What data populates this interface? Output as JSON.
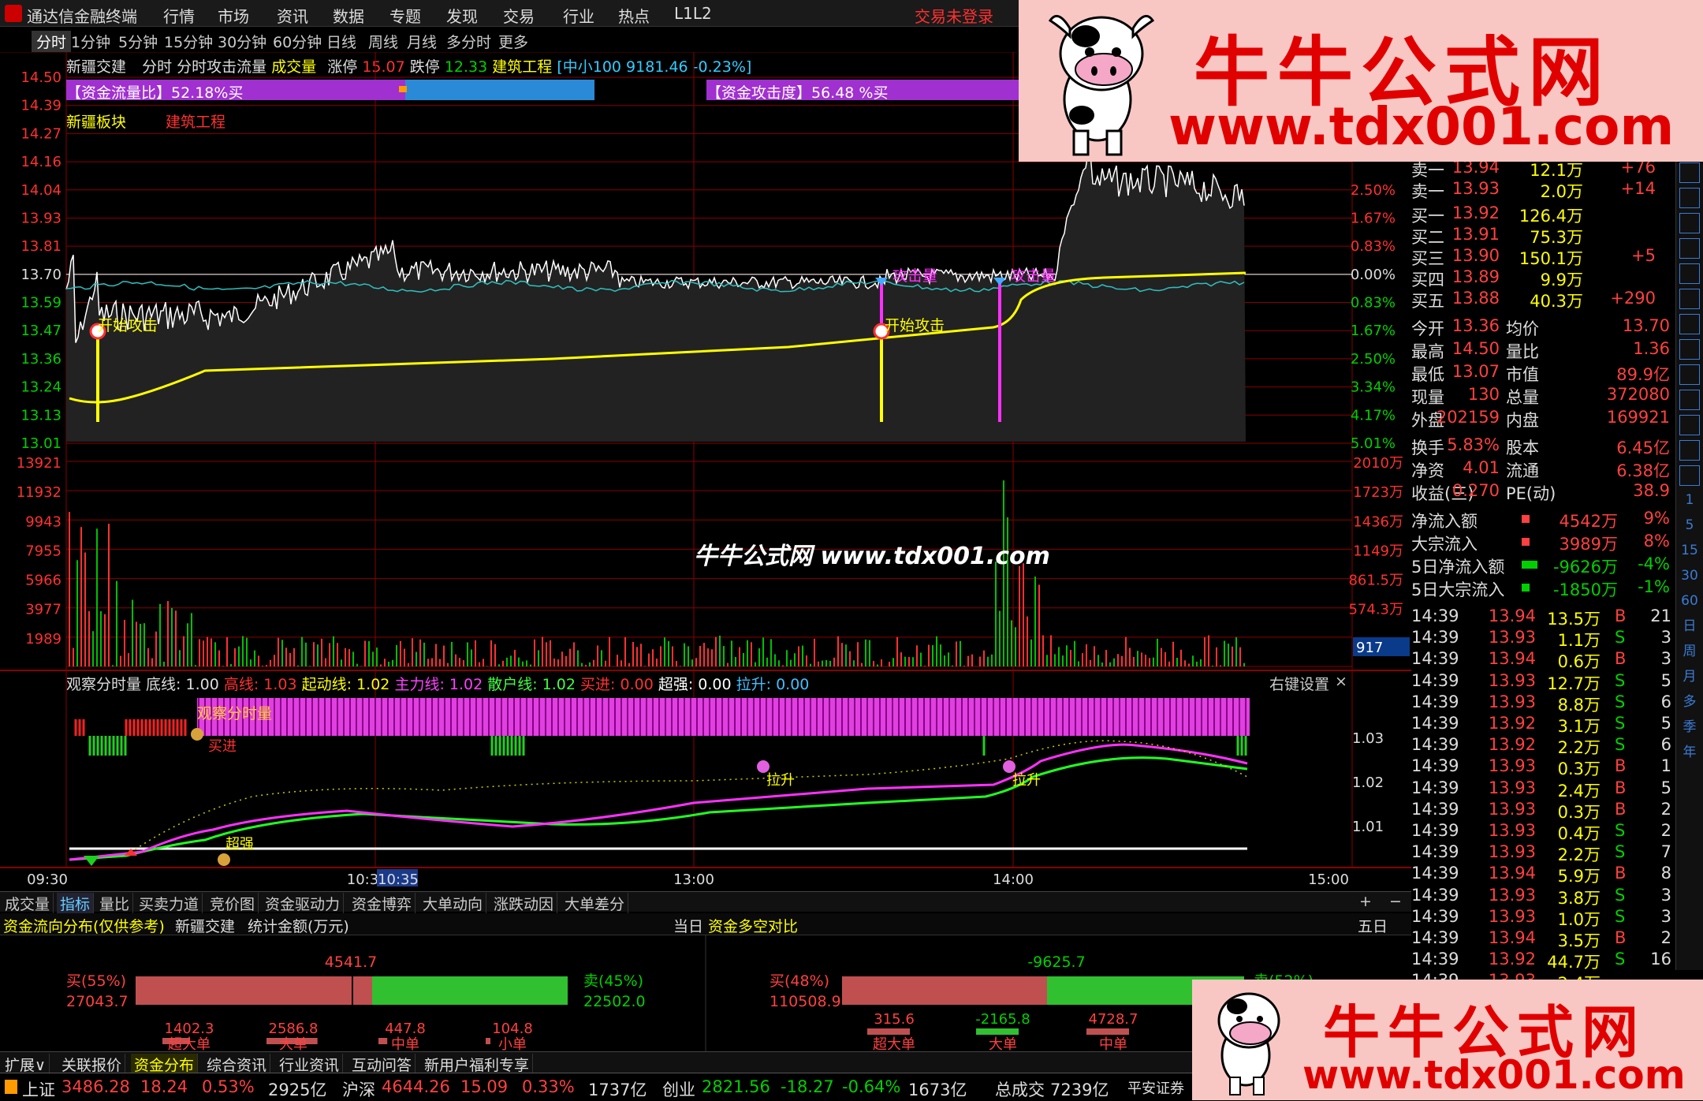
{
  "menubar": {
    "app_title": "通达信金融终端",
    "items": [
      "行情",
      "市场",
      "资讯",
      "数据",
      "专题",
      "发现",
      "交易",
      "行业",
      "热点",
      "L1L2"
    ],
    "login": "交易未登录"
  },
  "timeframes": [
    "分时",
    "1分钟",
    "5分钟",
    "15分钟",
    "30分钟",
    "60分钟",
    "日线",
    "周线",
    "月线",
    "多分时",
    "更多"
  ],
  "stock": {
    "name": "新疆交建",
    "view": "分时",
    "indicator": "分时攻击流量",
    "volume_label": "成交量",
    "limit_up_label": "涨停",
    "limit_up": "15.07",
    "limit_down_label": "跌停",
    "limit_down": "12.33",
    "sector": "建筑工程",
    "index_info": "[中小100 9181.46 -0.23%]"
  },
  "labels": {
    "sector_block": "新疆板块",
    "sector_name": "建筑工程",
    "flow_ratio": "【资金流量比】52.18%买",
    "attack_degree": "【资金攻击度】56.48 %买",
    "start_attack": "开始攻击",
    "attack_volume": "攻击量",
    "vol_box": "917"
  },
  "price_axis": [
    "14.50",
    "14.39",
    "14.27",
    "14.16",
    "14.04",
    "13.93",
    "13.81",
    "13.70",
    "13.59",
    "13.47",
    "13.36",
    "13.24",
    "13.13",
    "13.01"
  ],
  "pct_axis": [
    "2.50%",
    "1.67%",
    "0.83%",
    "0.00%",
    "0.83%",
    "1.67%",
    "2.50%",
    "3.34%",
    "4.17%",
    "5.01%"
  ],
  "vol_axis_left": [
    "13921",
    "11932",
    "9943",
    "7955",
    "5966",
    "3977",
    "1989"
  ],
  "vol_axis_right": [
    "2010万",
    "1723万",
    "1436万",
    "1149万",
    "861.5万",
    "574.3万"
  ],
  "indicator": {
    "title": "观察分时量",
    "params": [
      {
        "k": "底线:",
        "v": "1.00",
        "c": "#dddddd"
      },
      {
        "k": "高线:",
        "v": "1.03",
        "c": "#ff3030"
      },
      {
        "k": "起动线:",
        "v": "1.02",
        "c": "#ffff00"
      },
      {
        "k": "主力线:",
        "v": "1.02",
        "c": "#ff40ff"
      },
      {
        "k": "散户线:",
        "v": "1.02",
        "c": "#40ff40"
      },
      {
        "k": "买进:",
        "v": "0.00",
        "c": "#ff3030"
      },
      {
        "k": "超强:",
        "v": "0.00",
        "c": "#ffffff"
      },
      {
        "k": "拉升:",
        "v": "0.00",
        "c": "#40c0ff"
      }
    ],
    "right_settings": "右键设置",
    "axis": [
      "1.03",
      "1.02",
      "1.01"
    ],
    "band_label": "观察分时量",
    "buy_label": "买进",
    "strong_label": "超强",
    "lift_label": "拉升"
  },
  "time_axis": [
    "09:30",
    "10:3",
    "10:35",
    "13:00",
    "14:00",
    "15:00"
  ],
  "quote": {
    "sells": [
      [
        "卖一",
        "13.94",
        "12.1万",
        "+76"
      ],
      [
        "卖一",
        "13.93",
        "2.0万",
        "+14"
      ]
    ],
    "buys": [
      [
        "买一",
        "13.92",
        "126.4万",
        ""
      ],
      [
        "买二",
        "13.91",
        "75.3万",
        ""
      ],
      [
        "买三",
        "13.90",
        "150.1万",
        "+5"
      ],
      [
        "买四",
        "13.89",
        "9.9万",
        ""
      ],
      [
        "买五",
        "13.88",
        "40.3万",
        "+290"
      ]
    ],
    "stats": [
      [
        "今开",
        "13.36",
        "均价",
        "13.70"
      ],
      [
        "最高",
        "14.50",
        "量比",
        "1.36"
      ],
      [
        "最低",
        "13.07",
        "市值",
        "89.9亿"
      ],
      [
        "现量",
        "130",
        "总量",
        "372080"
      ],
      [
        "外盘",
        "202159",
        "内盘",
        "169921"
      ],
      [
        "换手",
        "5.83%",
        "股本",
        "6.45亿"
      ],
      [
        "净资",
        "4.01",
        "流通",
        "6.38亿"
      ],
      [
        "收益(三)",
        "0.270",
        "PE(动)",
        "38.9"
      ]
    ],
    "flows": [
      [
        "净流入额",
        "4542万",
        "9%"
      ],
      [
        "大宗流入",
        "3989万",
        "8%"
      ],
      [
        "5日净流入额",
        "-9626万",
        "-4%"
      ],
      [
        "5日大宗流入",
        "-1850万",
        "-1%"
      ]
    ],
    "ticks": [
      [
        "14:39",
        "13.94",
        "13.5万",
        "B",
        "21"
      ],
      [
        "14:39",
        "13.93",
        "1.1万",
        "S",
        "3"
      ],
      [
        "14:39",
        "13.94",
        "0.6万",
        "B",
        "3"
      ],
      [
        "14:39",
        "13.93",
        "12.7万",
        "S",
        "5"
      ],
      [
        "14:39",
        "13.93",
        "8.8万",
        "S",
        "6"
      ],
      [
        "14:39",
        "13.92",
        "3.1万",
        "S",
        "5"
      ],
      [
        "14:39",
        "13.92",
        "2.2万",
        "S",
        "6"
      ],
      [
        "14:39",
        "13.93",
        "0.3万",
        "B",
        "1"
      ],
      [
        "14:39",
        "13.93",
        "2.4万",
        "B",
        "5"
      ],
      [
        "14:39",
        "13.93",
        "0.3万",
        "B",
        "2"
      ],
      [
        "14:39",
        "13.93",
        "0.4万",
        "S",
        "2"
      ],
      [
        "14:39",
        "13.93",
        "2.2万",
        "S",
        "7"
      ],
      [
        "14:39",
        "13.94",
        "5.9万",
        "B",
        "8"
      ],
      [
        "14:39",
        "13.93",
        "3.8万",
        "S",
        "3"
      ],
      [
        "14:39",
        "13.93",
        "1.0万",
        "S",
        "3"
      ],
      [
        "14:39",
        "13.94",
        "3.5万",
        "B",
        "2"
      ],
      [
        "14:39",
        "13.92",
        "44.7万",
        "S",
        "16"
      ],
      [
        "14:39",
        "13.93",
        "2.4万",
        "",
        ""
      ]
    ]
  },
  "side_icons": [
    "1",
    "5",
    "15",
    "30",
    "60",
    "日",
    "周",
    "月",
    "多",
    "季",
    "年"
  ],
  "tabs": [
    "成交量",
    "指标",
    "量比",
    "买卖力道",
    "竞价图",
    "资金驱动力",
    "资金博弈",
    "大单动向",
    "涨跌动因",
    "大单差分"
  ],
  "fund": {
    "title": "资金流向分布(仅供参考)",
    "stock": "新疆交建",
    "unit": "统计金额(万元)",
    "day": "当日",
    "title2": "资金多空对比",
    "period": "五日",
    "net1": "4541.7",
    "buy1": "买(55%)",
    "buy1v": "27043.7",
    "sell1": "卖(45%)",
    "sell1v": "22502.0",
    "net2": "-9625.7",
    "buy2": "买(48%)",
    "buy2v": "110508.9",
    "sell2": "卖(52%)",
    "bars1": [
      [
        "超大单",
        "1402.3"
      ],
      [
        "大单",
        "2586.8"
      ],
      [
        "中单",
        "447.8"
      ],
      [
        "小单",
        "104.8"
      ]
    ],
    "bars2": [
      [
        "超大单",
        "315.6"
      ],
      [
        "大单",
        "-2165.8"
      ],
      [
        "中单",
        "4728.7"
      ]
    ]
  },
  "bottom_tabs": [
    "扩展∨",
    "关联报价",
    "资金分布",
    "综合资讯",
    "行业资讯",
    "互动问答",
    "新用户福利专享"
  ],
  "status": [
    {
      "n": "上证",
      "p": "3486.28",
      "c": "18.24",
      "pc": "0.53%",
      "v": "2925亿"
    },
    {
      "n": "沪深",
      "p": "4644.26",
      "c": "15.09",
      "pc": "0.33%",
      "v": "1737亿"
    },
    {
      "n": "创业",
      "p": "2821.56",
      "c": "-18.27",
      "pc": "-0.64%",
      "v": "1673亿"
    }
  ],
  "status_total": {
    "label": "总成交",
    "value": "7239亿",
    "broker": "平安证券"
  },
  "watermark": {
    "brand": "牛牛公式网",
    "url": "www.tdx001.com",
    "center": "牛牛公式网 www.tdx001.com"
  },
  "colors": {
    "up": "#ff3030",
    "down": "#00d000",
    "grid": "#8a0000",
    "avg": "#ffff00",
    "price": "#ffffff",
    "magenta": "#ff30ff"
  }
}
